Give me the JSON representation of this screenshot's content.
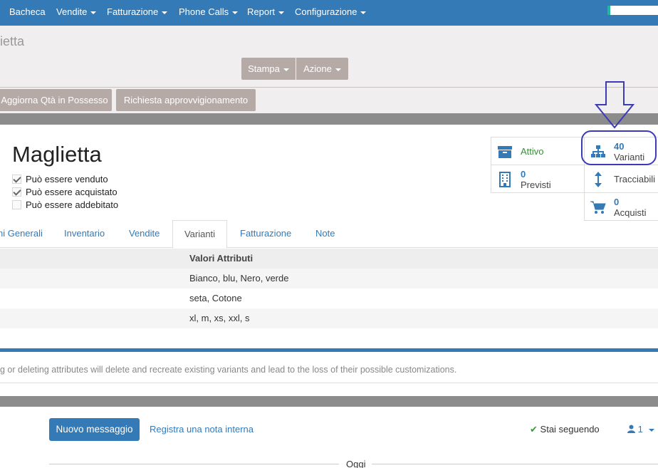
{
  "nav": {
    "items": [
      "Bacheca",
      "Vendite",
      "Fatturazione",
      "Phone Calls",
      "Report",
      "Configurazione"
    ]
  },
  "control_panel": {
    "breadcrumb": "ietta",
    "print_button": "Stampa",
    "action_button": "Azione",
    "update_qty_button": "Aggiorna Qtà in Possesso",
    "request_supply_button": "Richiesta approvvigionamento"
  },
  "product": {
    "name": "Maglietta",
    "checkboxes": [
      {
        "label": "Può essere venduto",
        "checked": true
      },
      {
        "label": "Può essere acquistato",
        "checked": true
      },
      {
        "label": "Può essere addebitato",
        "checked": false
      }
    ]
  },
  "smart_buttons": {
    "active": {
      "label": "Attivo",
      "icon": "archive-icon"
    },
    "variants": {
      "count": "40",
      "label": "Varianti",
      "icon": "sitemap-icon"
    },
    "forecast": {
      "count": "0",
      "label": "Previsti",
      "icon": "building-icon"
    },
    "traceability": {
      "label": "Tracciabili",
      "icon": "arrows-v-icon"
    },
    "purchases": {
      "count": "0",
      "label": "Acquisti",
      "icon": "cart-icon"
    }
  },
  "tabs": [
    "ni Generali",
    "Inventario",
    "Vendite",
    "Varianti",
    "Fatturazione",
    "Note"
  ],
  "active_tab": "Varianti",
  "attribute_table": {
    "header": "Valori Attributi",
    "rows": [
      "Bianco, blu, Nero, verde",
      "seta, Cotone",
      "xl, m, xs, xxl, s"
    ]
  },
  "warning": "g or deleting attributes will delete and recreate existing variants and lead to the loss of their possible customizations.",
  "chatter": {
    "new_message_button": "Nuovo messaggio",
    "log_note_link": "Registra una nota interna",
    "following": "Stai seguendo",
    "followers_count": "1",
    "today_label": "Oggi"
  },
  "colors": {
    "navbar": "#337ab7",
    "gray_button": "#b6aaa7",
    "annotation": "#3b3bb8"
  }
}
